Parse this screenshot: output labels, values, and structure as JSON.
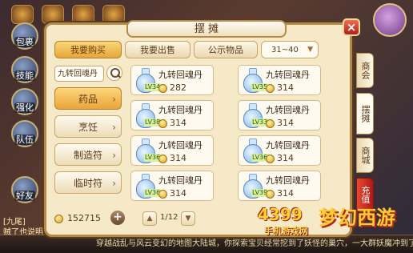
{
  "window": {
    "title": "摆 摊",
    "close_label": "×"
  },
  "tabs": [
    {
      "label": "我要购买",
      "active": true
    },
    {
      "label": "我要出售",
      "active": false
    },
    {
      "label": "公示物品",
      "active": false
    }
  ],
  "level_filter": {
    "value": "31~40"
  },
  "search": {
    "value": "九转回魂丹"
  },
  "categories": [
    {
      "label": "药品",
      "active": true
    },
    {
      "label": "烹饪",
      "active": false
    },
    {
      "label": "制造符",
      "active": false
    },
    {
      "label": "临时符",
      "active": false
    }
  ],
  "items": [
    {
      "name": "九转回魂丹",
      "lv": "LV34",
      "price": "282"
    },
    {
      "name": "九转回魂丹",
      "lv": "LV35",
      "price": "314"
    },
    {
      "name": "九转回魂丹",
      "lv": "LV38",
      "price": "314"
    },
    {
      "name": "九转回魂丹",
      "lv": "LV33",
      "price": "314"
    },
    {
      "name": "九转回魂丹",
      "lv": "LV36",
      "price": "314"
    },
    {
      "name": "九转回魂丹",
      "lv": "LV36",
      "price": "314"
    },
    {
      "name": "九转回魂丹",
      "lv": "LV36",
      "price": "314"
    },
    {
      "name": "九转回魂丹",
      "lv": "LV39",
      "price": "314"
    }
  ],
  "wallet": {
    "amount": "152715",
    "add_label": "+"
  },
  "pagination": {
    "current": "1/12",
    "up": "▲",
    "down": "▼"
  },
  "side_tabs": [
    {
      "label": "商会"
    },
    {
      "label": "摆摊"
    },
    {
      "label": "商城"
    },
    {
      "label": "充值"
    }
  ],
  "hud": {
    "left_buttons": [
      "包裹",
      "技能",
      "强化",
      "队伍",
      "好友"
    ],
    "chat_lines": [
      "[九尾]",
      "贼了也说明"
    ],
    "ticker": "穿越战乱与风云变幻的地图大陆城，你探索宝贝经常挖到了妖怪的巢穴，一大群妖魔冲到了两种山，大家快去刷妖啊！"
  },
  "logo": {
    "number": "4399",
    "brand": "梦幻西游",
    "sub": "手机游戏网"
  }
}
